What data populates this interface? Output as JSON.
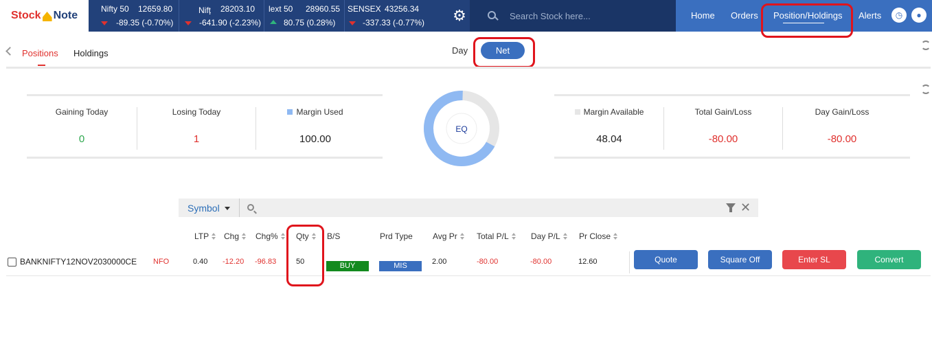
{
  "logo": {
    "part1": "Stock",
    "part2": "Note"
  },
  "tickers": [
    {
      "name": "Nifty 50",
      "price": "12659.80",
      "change": "-89.35 (-0.70%)",
      "direction": "down"
    },
    {
      "name": "Niftฺ",
      "price": "28203.10",
      "change": "-641.90 (-2.23%)",
      "direction": "down"
    },
    {
      "name": "lext 50",
      "price": "28960.55",
      "change": "80.75 (0.28%)",
      "direction": "up"
    },
    {
      "name": "SENSEX",
      "price": "43256.34",
      "change": "-337.33 (-0.77%)",
      "direction": "down"
    }
  ],
  "search": {
    "placeholder": "Search Stock here..."
  },
  "nav": {
    "home": "Home",
    "orders": "Orders",
    "positions": "Position/Holdings",
    "alerts": "Alerts"
  },
  "tabs": {
    "positions": "Positions",
    "holdings": "Holdings"
  },
  "toggle": {
    "day": "Day",
    "net": "Net"
  },
  "stats": {
    "gaining_label": "Gaining Today",
    "gaining_value": "0",
    "losing_label": "Losing Today",
    "losing_value": "1",
    "margin_used_label": "Margin Used",
    "margin_used_value": "100.00",
    "margin_available_label": "Margin Available",
    "margin_available_value": "48.04",
    "total_gl_label": "Total Gain/Loss",
    "total_gl_value": "-80.00",
    "day_gl_label": "Day Gain/Loss",
    "day_gl_value": "-80.00"
  },
  "donut": {
    "label": "EQ",
    "used_fraction": 0.675,
    "used_color": "#8fb9f2",
    "available_color": "#e6e6e6"
  },
  "filter": {
    "field": "Symbol"
  },
  "columns": {
    "ltp": "LTP",
    "chg": "Chg",
    "chg_pct": "Chg%",
    "qty": "Qty",
    "bs": "B/S",
    "prd_type": "Prd Type",
    "avg_pr": "Avg Pr",
    "total_pl": "Total P/L",
    "day_pl": "Day P/L",
    "pr_close": "Pr Close"
  },
  "rows": [
    {
      "symbol": "BANKNIFTY12NOV2030000CE",
      "exchange": "NFO",
      "ltp": "0.40",
      "chg": "-12.20",
      "chg_pct": "-96.83",
      "qty": "50",
      "bs": "BUY",
      "prd_type": "MIS",
      "avg_pr": "2.00",
      "total_pl": "-80.00",
      "day_pl": "-80.00",
      "pr_close": "12.60"
    }
  ],
  "actions": {
    "quote": "Quote",
    "square_off": "Square Off",
    "enter_sl": "Enter SL",
    "convert": "Convert"
  },
  "colors": {
    "header": "#22417a",
    "nav": "#3a6fbf",
    "loss": "#e0312e",
    "gain": "#2fa84f",
    "buy": "#138a1e",
    "enter_sl": "#e8474c",
    "convert": "#2fb37c"
  }
}
